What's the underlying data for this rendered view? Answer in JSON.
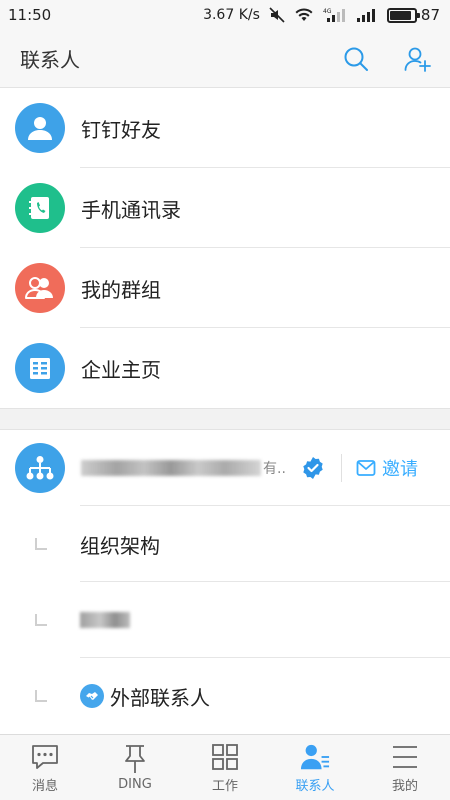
{
  "status": {
    "time": "11:50",
    "speed": "3.67 K/s",
    "net_label": "4G",
    "battery": "87",
    "battery_fraction": 0.87
  },
  "header": {
    "title": "联系人",
    "search_icon": "search-icon",
    "add_icon": "add-contact-icon"
  },
  "menu": [
    {
      "label": "钉钉好友",
      "icon": "person-icon",
      "color": "#3ea2e8"
    },
    {
      "label": "手机通讯录",
      "icon": "phone-book-icon",
      "color": "#1fbf8c"
    },
    {
      "label": "我的群组",
      "icon": "group-icon",
      "color": "#f06c5a"
    },
    {
      "label": "企业主页",
      "icon": "building-icon",
      "color": "#3ea2e8"
    }
  ],
  "org": {
    "name_ellipsis": "有..",
    "invite_label": "邀请",
    "accent": "#38adff"
  },
  "sub_items": [
    {
      "label": "组织架构"
    },
    {
      "label": ""
    },
    {
      "label": "外部联系人"
    }
  ],
  "nav": [
    {
      "label": "消息",
      "icon": "chat-bubble-icon"
    },
    {
      "label": "DING",
      "icon": "pin-icon"
    },
    {
      "label": "工作",
      "icon": "grid-icon"
    },
    {
      "label": "联系人",
      "icon": "contacts-icon",
      "active": true
    },
    {
      "label": "我的",
      "icon": "menu-icon"
    }
  ]
}
